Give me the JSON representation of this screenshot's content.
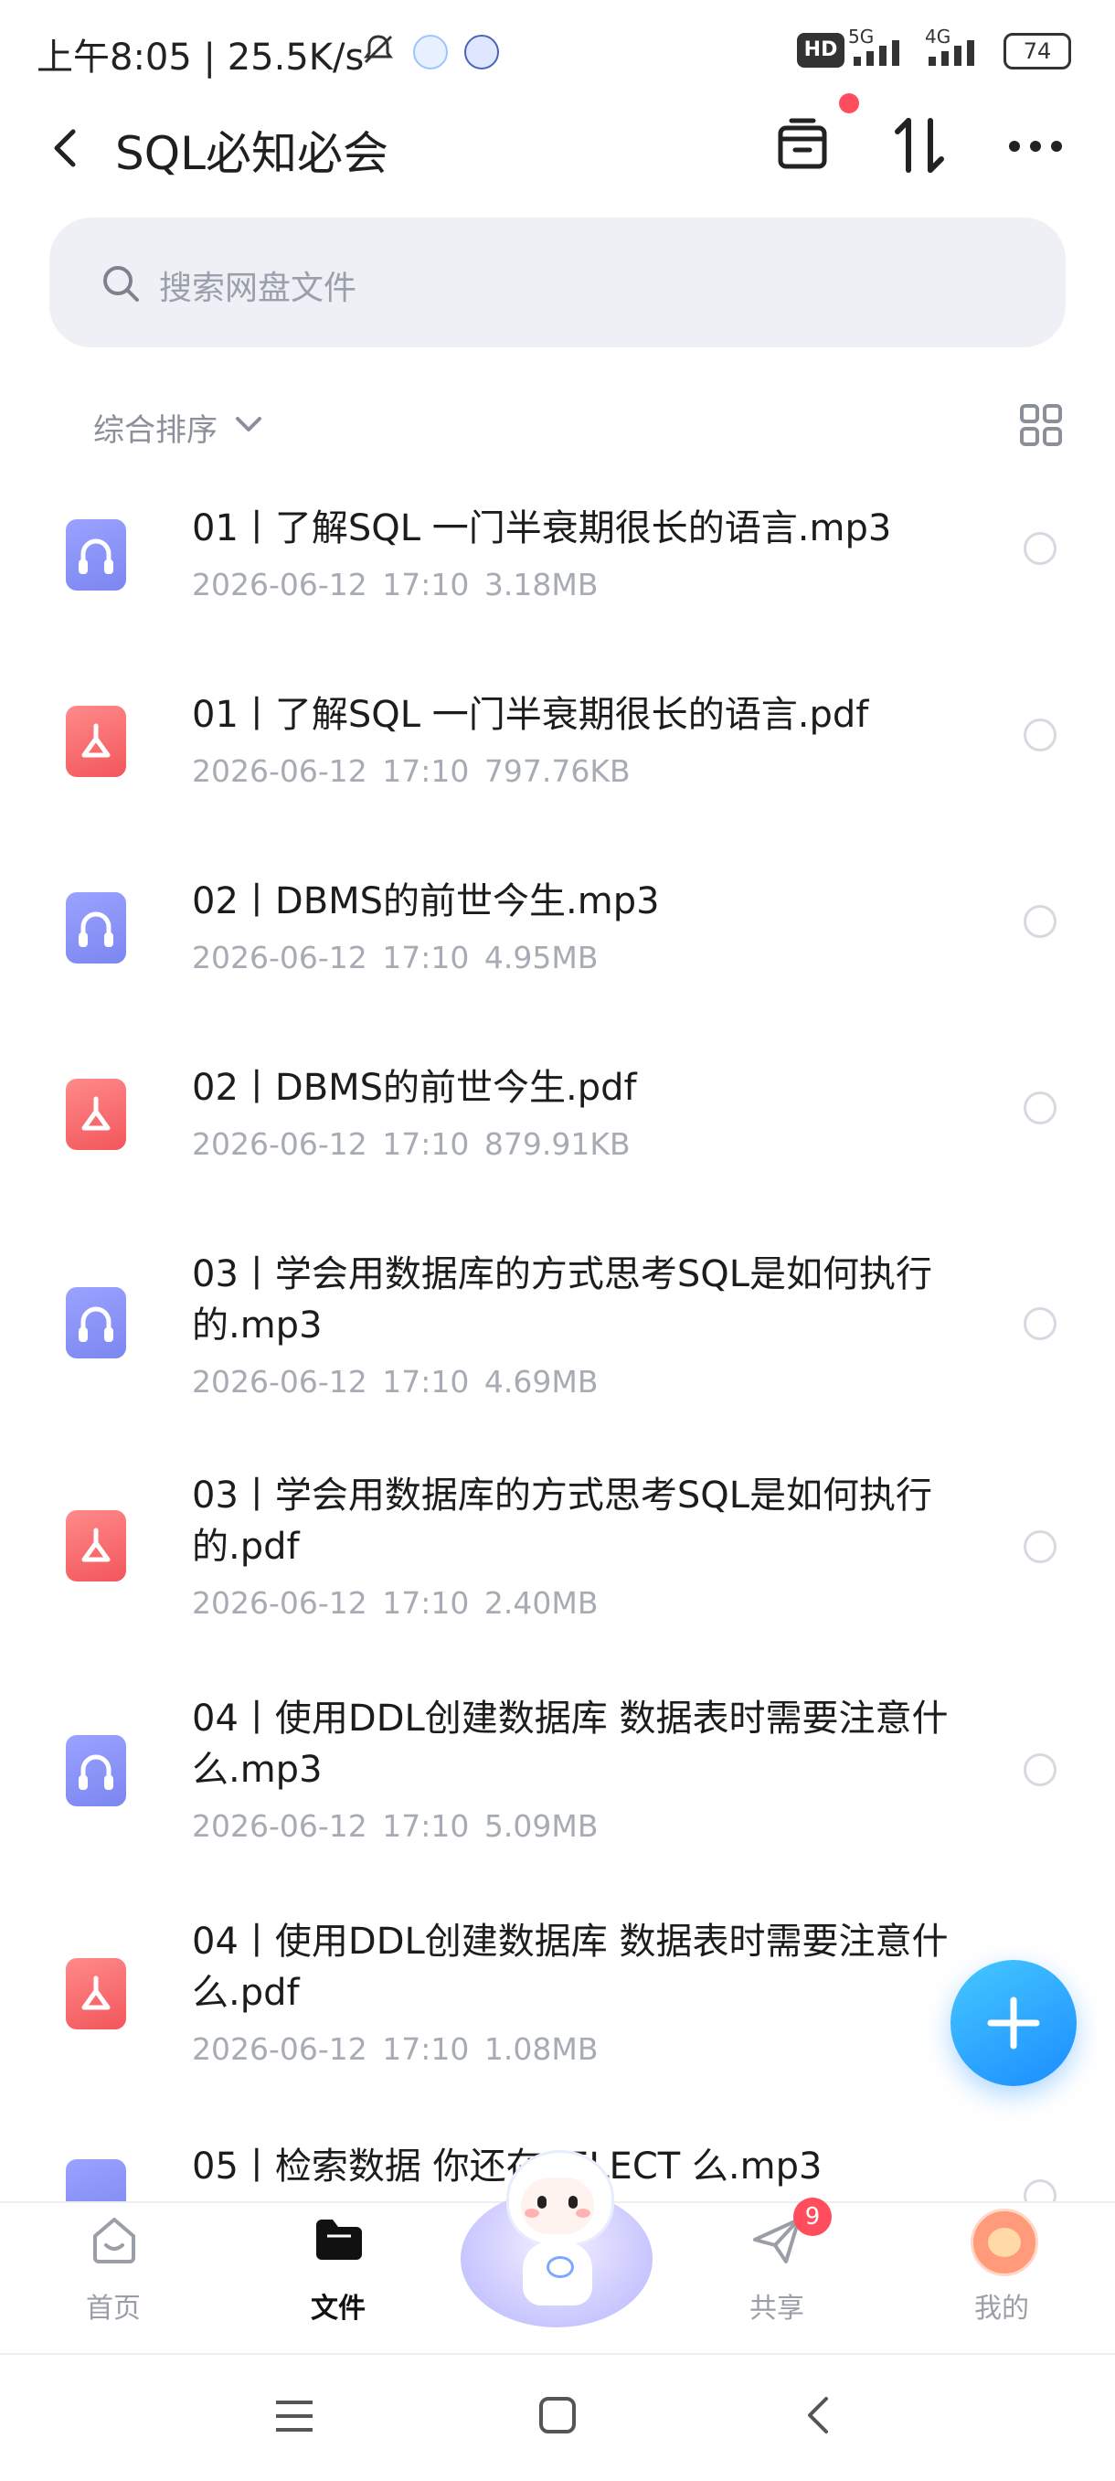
{
  "status_bar": {
    "time": "上午8:05",
    "speed": "25.5K/s",
    "network_5g": "5G",
    "network_4g": "4G",
    "hd_label": "HD",
    "battery": "74"
  },
  "header": {
    "title": "SQL必知必会"
  },
  "search": {
    "placeholder": "搜索网盘文件"
  },
  "sort": {
    "label": "综合排序"
  },
  "files": [
    {
      "type": "audio",
      "name": "01丨了解SQL 一门半衰期很长的语言.mp3",
      "date": "2026-06-12",
      "time": "17:10",
      "size": "3.18MB"
    },
    {
      "type": "pdf",
      "name": "01丨了解SQL 一门半衰期很长的语言.pdf",
      "date": "2026-06-12",
      "time": "17:10",
      "size": "797.76KB"
    },
    {
      "type": "audio",
      "name": "02丨DBMS的前世今生.mp3",
      "date": "2026-06-12",
      "time": "17:10",
      "size": "4.95MB"
    },
    {
      "type": "pdf",
      "name": "02丨DBMS的前世今生.pdf",
      "date": "2026-06-12",
      "time": "17:10",
      "size": "879.91KB"
    },
    {
      "type": "audio",
      "name": "03丨学会用数据库的方式思考SQL是如何执行的.mp3",
      "date": "2026-06-12",
      "time": "17:10",
      "size": "4.69MB"
    },
    {
      "type": "pdf",
      "name": "03丨学会用数据库的方式思考SQL是如何执行的.pdf",
      "date": "2026-06-12",
      "time": "17:10",
      "size": "2.40MB"
    },
    {
      "type": "audio",
      "name": "04丨使用DDL创建数据库 数据表时需要注意什么.mp3",
      "date": "2026-06-12",
      "time": "17:10",
      "size": "5.09MB"
    },
    {
      "type": "pdf",
      "name": "04丨使用DDL创建数据库 数据表时需要注意什么.pdf",
      "date": "2026-06-12",
      "time": "17:10",
      "size": "1.08MB"
    },
    {
      "type": "audio",
      "name": "05丨检索数据 你还在SELECT 么.mp3",
      "date": "",
      "time": "",
      "size": ""
    }
  ],
  "bottom_nav": {
    "home": "首页",
    "files": "文件",
    "share": "共享",
    "share_badge": "9",
    "mine": "我的"
  },
  "colors": {
    "accent": "#1a8dff",
    "audio_icon": "#8890f5",
    "pdf_icon": "#f45d62",
    "badge": "#ff4d5e"
  }
}
